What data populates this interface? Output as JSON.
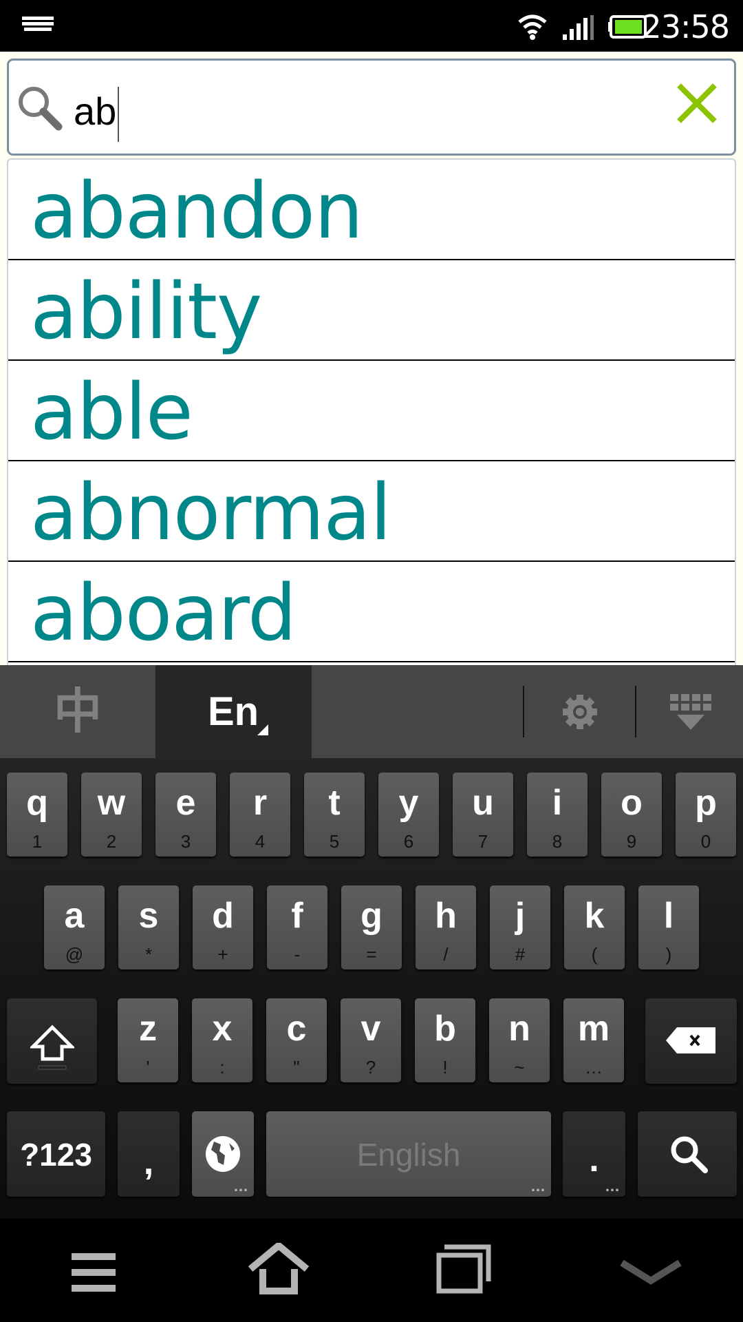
{
  "status_bar": {
    "time": "23:58",
    "battery_color": "#6ee01f",
    "icons": [
      "keyboard-icon",
      "wifi-icon",
      "signal-icon",
      "battery-icon"
    ]
  },
  "search": {
    "query": "ab",
    "clear_color": "#8cc400"
  },
  "suggestions": [
    "abandon",
    "ability",
    "able",
    "abnormal",
    "aboard"
  ],
  "keyboard": {
    "chinese_tab": "中",
    "english_tab": "En",
    "rows": [
      [
        [
          "q",
          "1"
        ],
        [
          "w",
          "2"
        ],
        [
          "e",
          "3"
        ],
        [
          "r",
          "4"
        ],
        [
          "t",
          "5"
        ],
        [
          "y",
          "6"
        ],
        [
          "u",
          "7"
        ],
        [
          "i",
          "8"
        ],
        [
          "o",
          "9"
        ],
        [
          "p",
          "0"
        ]
      ],
      [
        [
          "a",
          "@"
        ],
        [
          "s",
          "*"
        ],
        [
          "d",
          "+"
        ],
        [
          "f",
          "-"
        ],
        [
          "g",
          "="
        ],
        [
          "h",
          "/"
        ],
        [
          "j",
          "#"
        ],
        [
          "k",
          "("
        ],
        [
          "l",
          ")"
        ]
      ],
      [
        [
          "z",
          "'"
        ],
        [
          "x",
          ":"
        ],
        [
          "c",
          "\""
        ],
        [
          "v",
          "?"
        ],
        [
          "b",
          "!"
        ],
        [
          "n",
          "~"
        ],
        [
          "m",
          "…"
        ]
      ]
    ],
    "symbols_label": "?123",
    "comma": ",",
    "period": ".",
    "space_label": "English"
  },
  "nav": [
    "menu-icon",
    "home-icon",
    "recent-apps-icon",
    "hide-keyboard-icon"
  ]
}
